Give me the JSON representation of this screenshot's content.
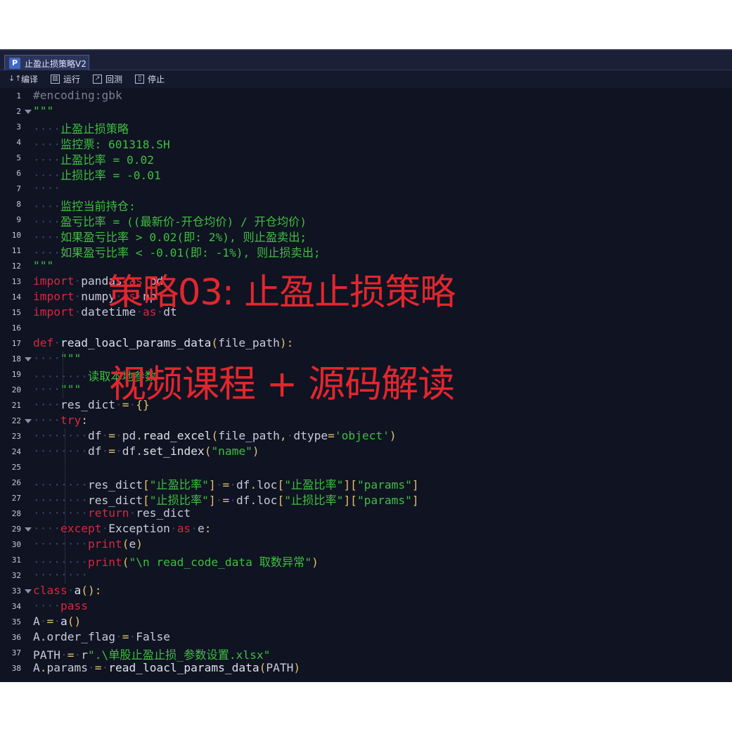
{
  "window": {
    "tab_icon_letter": "P",
    "tab_title": "止盈止损策略V2"
  },
  "toolbar": {
    "compile_label": "编译",
    "run_label": "运行",
    "backtest_label": "回测",
    "stop_label": "停止"
  },
  "editor": {
    "line_numbers": [
      "1",
      "2",
      "3",
      "4",
      "5",
      "6",
      "7",
      "8",
      "9",
      "10",
      "11",
      "12",
      "13",
      "14",
      "15",
      "16",
      "17",
      "18",
      "19",
      "20",
      "21",
      "22",
      "23",
      "24",
      "25",
      "26",
      "27",
      "28",
      "29",
      "30",
      "31",
      "32",
      "33",
      "34",
      "35",
      "36",
      "37",
      "38"
    ],
    "fold_lines": [
      2,
      18,
      22,
      29,
      33
    ],
    "lines": [
      [
        [
          "cm",
          "#encoding:gbk"
        ]
      ],
      [
        [
          "st",
          "\"\"\""
        ]
      ],
      [
        [
          "ws",
          "····"
        ],
        [
          "st",
          "止盈止损策略"
        ]
      ],
      [
        [
          "ws",
          "····"
        ],
        [
          "st",
          "监控票: 601318.SH"
        ]
      ],
      [
        [
          "ws",
          "····"
        ],
        [
          "st",
          "止盈比率 = 0.02"
        ]
      ],
      [
        [
          "ws",
          "····"
        ],
        [
          "st",
          "止损比率 = -0.01"
        ]
      ],
      [
        [
          "ws",
          "····"
        ]
      ],
      [
        [
          "ws",
          "····"
        ],
        [
          "st",
          "监控当前持仓:"
        ]
      ],
      [
        [
          "ws",
          "····"
        ],
        [
          "st",
          "盈亏比率 = ((最新价-开仓均价) / 开仓均价)"
        ]
      ],
      [
        [
          "ws",
          "····"
        ],
        [
          "st",
          "如果盈亏比率 > 0.02(即: 2%), 则止盈卖出;"
        ]
      ],
      [
        [
          "ws",
          "····"
        ],
        [
          "st",
          "如果盈亏比率 < -0.01(即: -1%), 则止损卖出;"
        ]
      ],
      [
        [
          "st",
          "\"\"\""
        ]
      ],
      [
        [
          "kw",
          "import"
        ],
        [
          "ws",
          "·"
        ],
        [
          "nm",
          "pandas"
        ],
        [
          "ws",
          "·"
        ],
        [
          "kw",
          "as"
        ],
        [
          "ws",
          "·"
        ],
        [
          "nm",
          "pd"
        ]
      ],
      [
        [
          "kw",
          "import"
        ],
        [
          "ws",
          "·"
        ],
        [
          "nm",
          "numpy"
        ],
        [
          "ws",
          "·"
        ],
        [
          "kw",
          "as"
        ],
        [
          "ws",
          "·"
        ],
        [
          "nm",
          "np"
        ]
      ],
      [
        [
          "kw",
          "import"
        ],
        [
          "ws",
          "·"
        ],
        [
          "nm",
          "datetime"
        ],
        [
          "ws",
          "·"
        ],
        [
          "kw",
          "as"
        ],
        [
          "ws",
          "·"
        ],
        [
          "nm",
          "dt"
        ]
      ],
      [],
      [
        [
          "kw",
          "def"
        ],
        [
          "ws",
          "·"
        ],
        [
          "fn",
          "read_loacl_params_data"
        ],
        [
          "op",
          "("
        ],
        [
          "nm",
          "file_path"
        ],
        [
          "op",
          "):"
        ]
      ],
      [
        [
          "ws",
          "····"
        ],
        [
          "st",
          "\"\"\""
        ]
      ],
      [
        [
          "ws",
          "········"
        ],
        [
          "st",
          "读取本地参数"
        ]
      ],
      [
        [
          "ws",
          "····"
        ],
        [
          "st",
          "\"\"\""
        ]
      ],
      [
        [
          "ws",
          "····"
        ],
        [
          "nm",
          "res_dict"
        ],
        [
          "ws",
          "·"
        ],
        [
          "op",
          "="
        ],
        [
          "ws",
          "·"
        ],
        [
          "op",
          "{}"
        ]
      ],
      [
        [
          "ws",
          "····"
        ],
        [
          "kw",
          "try"
        ],
        [
          "op",
          ":"
        ]
      ],
      [
        [
          "ws",
          "········"
        ],
        [
          "nm",
          "df"
        ],
        [
          "ws",
          "·"
        ],
        [
          "op",
          "="
        ],
        [
          "ws",
          "·"
        ],
        [
          "nm",
          "pd"
        ],
        [
          "op",
          "."
        ],
        [
          "fn",
          "read_excel"
        ],
        [
          "op",
          "("
        ],
        [
          "nm",
          "file_path"
        ],
        [
          "op",
          ","
        ],
        [
          "ws",
          "·"
        ],
        [
          "nm",
          "dtype"
        ],
        [
          "op",
          "="
        ],
        [
          "st",
          "'object'"
        ],
        [
          "op",
          ")"
        ]
      ],
      [
        [
          "ws",
          "········"
        ],
        [
          "nm",
          "df"
        ],
        [
          "ws",
          "·"
        ],
        [
          "op",
          "="
        ],
        [
          "ws",
          "·"
        ],
        [
          "nm",
          "df"
        ],
        [
          "op",
          "."
        ],
        [
          "fn",
          "set_index"
        ],
        [
          "op",
          "("
        ],
        [
          "st",
          "\"name\""
        ],
        [
          "op",
          ")"
        ]
      ],
      [],
      [
        [
          "ws",
          "········"
        ],
        [
          "nm",
          "res_dict"
        ],
        [
          "op",
          "["
        ],
        [
          "st",
          "\"止盈比率\""
        ],
        [
          "op",
          "]"
        ],
        [
          "ws",
          "·"
        ],
        [
          "op",
          "="
        ],
        [
          "ws",
          "·"
        ],
        [
          "nm",
          "df"
        ],
        [
          "op",
          "."
        ],
        [
          "nm",
          "loc"
        ],
        [
          "op",
          "["
        ],
        [
          "st",
          "\"止盈比率\""
        ],
        [
          "op",
          "]["
        ],
        [
          "st",
          "\"params\""
        ],
        [
          "op",
          "]"
        ]
      ],
      [
        [
          "ws",
          "········"
        ],
        [
          "nm",
          "res_dict"
        ],
        [
          "op",
          "["
        ],
        [
          "st",
          "\"止损比率\""
        ],
        [
          "op",
          "]"
        ],
        [
          "ws",
          "·"
        ],
        [
          "op",
          "="
        ],
        [
          "ws",
          "·"
        ],
        [
          "nm",
          "df"
        ],
        [
          "op",
          "."
        ],
        [
          "nm",
          "loc"
        ],
        [
          "op",
          "["
        ],
        [
          "st",
          "\"止损比率\""
        ],
        [
          "op",
          "]["
        ],
        [
          "st",
          "\"params\""
        ],
        [
          "op",
          "]"
        ]
      ],
      [
        [
          "ws",
          "········"
        ],
        [
          "kw",
          "return"
        ],
        [
          "ws",
          "·"
        ],
        [
          "nm",
          "res_dict"
        ]
      ],
      [
        [
          "ws",
          "····"
        ],
        [
          "kw",
          "except"
        ],
        [
          "ws",
          "·"
        ],
        [
          "nm",
          "Exception"
        ],
        [
          "ws",
          "·"
        ],
        [
          "kw",
          "as"
        ],
        [
          "ws",
          "·"
        ],
        [
          "nm",
          "e"
        ],
        [
          "op",
          ":"
        ]
      ],
      [
        [
          "ws",
          "········"
        ],
        [
          "kw",
          "print"
        ],
        [
          "op",
          "("
        ],
        [
          "nm",
          "e"
        ],
        [
          "op",
          ")"
        ]
      ],
      [
        [
          "ws",
          "········"
        ],
        [
          "kw",
          "print"
        ],
        [
          "op",
          "("
        ],
        [
          "st",
          "\"\\n read_code_data 取数异常\""
        ],
        [
          "op",
          ")"
        ]
      ],
      [
        [
          "ws",
          "········"
        ]
      ],
      [
        [
          "kw",
          "class"
        ],
        [
          "ws",
          "·"
        ],
        [
          "fn",
          "a"
        ],
        [
          "op",
          "():"
        ]
      ],
      [
        [
          "ws",
          "····"
        ],
        [
          "kw",
          "pass"
        ]
      ],
      [
        [
          "nm",
          "A"
        ],
        [
          "ws",
          "·"
        ],
        [
          "op",
          "="
        ],
        [
          "ws",
          "·"
        ],
        [
          "fn",
          "a"
        ],
        [
          "op",
          "()"
        ]
      ],
      [
        [
          "nm",
          "A"
        ],
        [
          "op",
          "."
        ],
        [
          "nm",
          "order_flag"
        ],
        [
          "ws",
          "·"
        ],
        [
          "op",
          "="
        ],
        [
          "ws",
          "·"
        ],
        [
          "nm",
          "False"
        ]
      ],
      [
        [
          "nm",
          "PATH"
        ],
        [
          "ws",
          "·"
        ],
        [
          "op",
          "="
        ],
        [
          "ws",
          "·"
        ],
        [
          "nm",
          "r"
        ],
        [
          "st",
          "\".\\单股止盈止损_参数设置.xlsx\""
        ]
      ],
      [
        [
          "nm",
          "A"
        ],
        [
          "op",
          "."
        ],
        [
          "nm",
          "params"
        ],
        [
          "ws",
          "·"
        ],
        [
          "op",
          "="
        ],
        [
          "ws",
          "·"
        ],
        [
          "fn",
          "read_loacl_params_data"
        ],
        [
          "op",
          "("
        ],
        [
          "nm",
          "PATH"
        ],
        [
          "op",
          ")"
        ]
      ]
    ]
  },
  "overlay": {
    "title_text": "策略03: 止盈止损策略",
    "subtitle_text": "视频课程 + 源码解读",
    "color": "#e3262d"
  }
}
